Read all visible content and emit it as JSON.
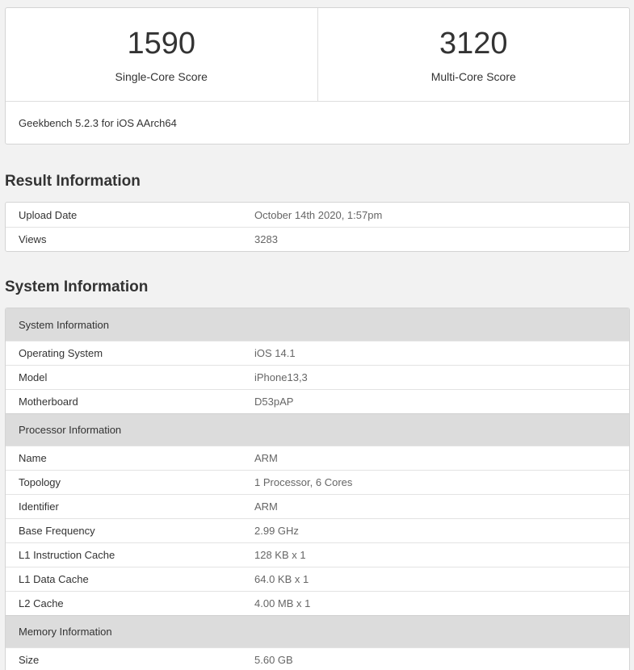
{
  "scores": {
    "single_core_value": "1590",
    "single_core_label": "Single-Core Score",
    "multi_core_value": "3120",
    "multi_core_label": "Multi-Core Score",
    "version": "Geekbench 5.2.3 for iOS AArch64"
  },
  "result_information": {
    "title": "Result Information",
    "rows": [
      {
        "key": "Upload Date",
        "value": "October 14th 2020, 1:57pm"
      },
      {
        "key": "Views",
        "value": "3283"
      }
    ]
  },
  "system_information": {
    "title": "System Information",
    "groups": [
      {
        "header": "System Information",
        "rows": [
          {
            "key": "Operating System",
            "value": "iOS 14.1"
          },
          {
            "key": "Model",
            "value": "iPhone13,3"
          },
          {
            "key": "Motherboard",
            "value": "D53pAP"
          }
        ]
      },
      {
        "header": "Processor Information",
        "rows": [
          {
            "key": "Name",
            "value": "ARM"
          },
          {
            "key": "Topology",
            "value": "1 Processor, 6 Cores"
          },
          {
            "key": "Identifier",
            "value": "ARM"
          },
          {
            "key": "Base Frequency",
            "value": "2.99 GHz"
          },
          {
            "key": "L1 Instruction Cache",
            "value": "128 KB x 1"
          },
          {
            "key": "L1 Data Cache",
            "value": "64.0 KB x 1"
          },
          {
            "key": "L2 Cache",
            "value": "4.00 MB x 1"
          }
        ]
      },
      {
        "header": "Memory Information",
        "rows": [
          {
            "key": "Size",
            "value": "5.60 GB"
          }
        ]
      }
    ]
  }
}
